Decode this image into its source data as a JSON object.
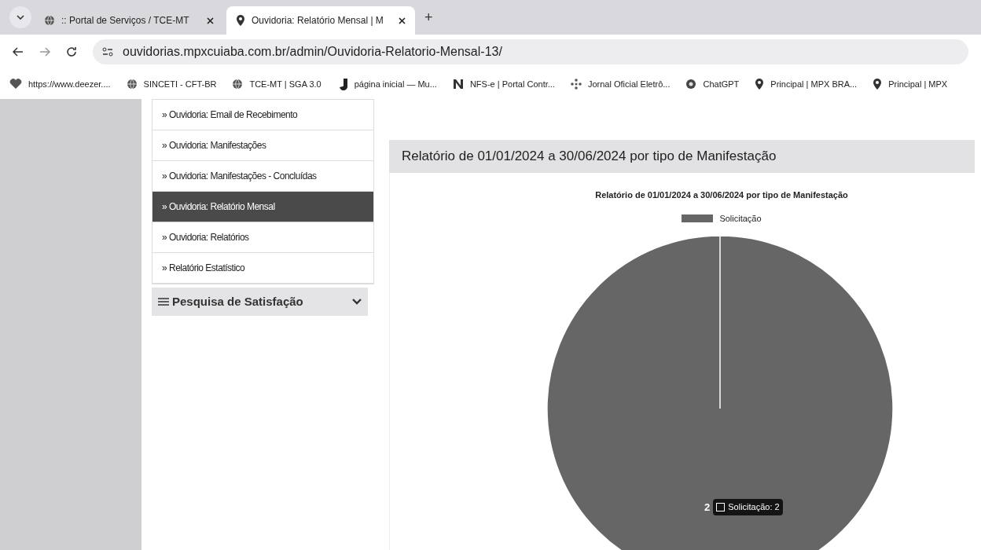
{
  "browser": {
    "tabs": [
      {
        "title": ":: Portal de Serviços / TCE-MT",
        "selected": false
      },
      {
        "title": "Ouvidoria: Relatório Mensal | M",
        "selected": true
      }
    ],
    "new_tab": "+",
    "url": "ouvidorias.mpxcuiaba.com.br/admin/Ouvidoria-Relatorio-Mensal-13/",
    "bookmarks": [
      "https://www.deezer....",
      "SINCETI - CFT-BR",
      "TCE-MT | SGA 3.0",
      "página inicial — Mu...",
      "NFS-e | Portal Contr...",
      "Jornal Oficial Eletrô...",
      "ChatGPT",
      "Principal | MPX BRA...",
      "Principal | MPX"
    ]
  },
  "sidebar": {
    "items": [
      {
        "label": "» Ouvidoria: Email de Recebimento",
        "selected": false
      },
      {
        "label": "» Ouvidoria: Manifestações",
        "selected": false
      },
      {
        "label": "» Ouvidoria: Manifestações - Concluídas",
        "selected": false
      },
      {
        "label": "» Ouvidoria: Relatório Mensal",
        "selected": true
      },
      {
        "label": "» Ouvidoria: Relatórios",
        "selected": false
      },
      {
        "label": "» Relatório Estatístico",
        "selected": false
      }
    ],
    "section": {
      "label": "Pesquisa de Satisfação",
      "expanded": false
    }
  },
  "panel": {
    "title": "Relatório de 01/01/2024 a 30/06/2024 por tipo de Manifestação",
    "chart_data": {
      "type": "pie",
      "title": "Relatório de 01/01/2024  a 30/06/2024 por tipo de Manifestação",
      "categories": [
        "Solicitação"
      ],
      "series": [
        {
          "color": "#666666",
          "values": [
            2
          ]
        }
      ],
      "data_labels": true
    },
    "tooltip": "Solicitação: 2"
  }
}
